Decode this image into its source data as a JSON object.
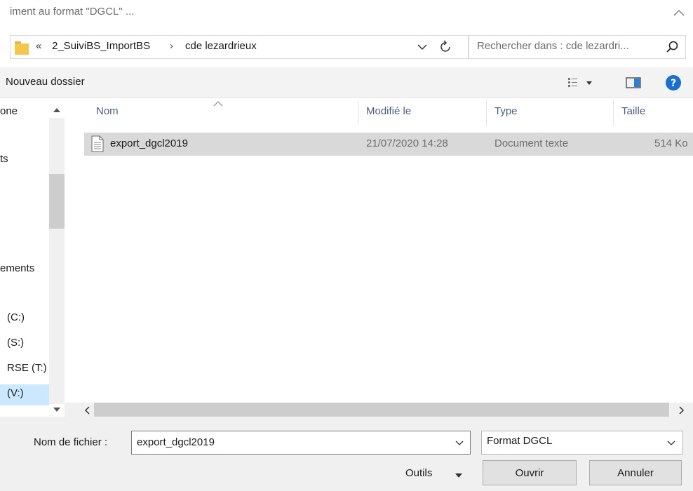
{
  "window": {
    "title": "iment au format \"DGCL\" ..."
  },
  "address": {
    "separator_overflow": "«",
    "crumbs": [
      "2_SuiviBS_ImportBS",
      "cde lezardrieux"
    ],
    "crumb_separator": "›"
  },
  "search": {
    "placeholder": "Rechercher dans : cde lezardri..."
  },
  "toolbar": {
    "new_folder_label": "Nouveau dossier"
  },
  "navpane": {
    "items": [
      "one",
      "ts",
      "ements",
      "(C:)",
      "(S:)",
      "RSE (T:)",
      "(V:)"
    ]
  },
  "columns": {
    "name": "Nom",
    "modified": "Modifié le",
    "type": "Type",
    "size": "Taille"
  },
  "files": [
    {
      "name": "export_dgcl2019",
      "modified": "21/07/2020 14:28",
      "type": "Document texte",
      "size": "514 Ko"
    }
  ],
  "footer": {
    "filename_label": "Nom de fichier :",
    "filename_value": "export_dgcl2019",
    "filetype_value": "Format DGCL",
    "tools_label": "Outils",
    "open_label": "Ouvrir",
    "cancel_label": "Annuler"
  },
  "colors": {
    "selection": "#cce8ff",
    "row_highlight": "#d9d9d9",
    "folder": "#f4c64b",
    "help": "#1a6fd1"
  }
}
